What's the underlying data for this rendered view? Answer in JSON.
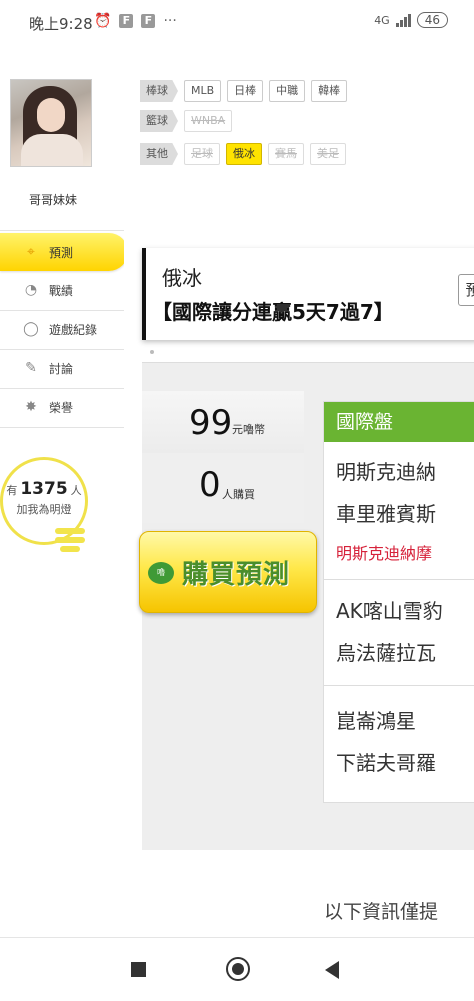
{
  "status_bar": {
    "time": "晚上9:28",
    "alarm_icon": "alarm-clock-icon",
    "notification_icons": [
      "F",
      "F"
    ],
    "more": "···",
    "network": "4G",
    "battery": "46"
  },
  "sidebar": {
    "user_name": "哥哥妹妹",
    "menu": [
      {
        "label": "預測",
        "icon": "target-icon",
        "active": true
      },
      {
        "label": "戰績",
        "icon": "chart-icon",
        "active": false
      },
      {
        "label": "遊戲紀錄",
        "icon": "record-icon",
        "active": false
      },
      {
        "label": "討論",
        "icon": "discussion-icon",
        "active": false
      },
      {
        "label": "榮譽",
        "icon": "honor-icon",
        "active": false
      }
    ],
    "lamp": {
      "prefix": "有",
      "count": "1375",
      "suffix": "人",
      "subtitle": "加我為明燈"
    }
  },
  "filters": {
    "baseball": {
      "category": "棒球",
      "tags": [
        "MLB",
        "日棒",
        "中職",
        "韓棒"
      ]
    },
    "basketball": {
      "category": "籃球",
      "tags": [
        "WNBA"
      ]
    },
    "other": {
      "category": "其他",
      "tags": [
        "足球",
        "俄冰",
        "賽馬",
        "美足"
      ],
      "selected": "俄冰"
    }
  },
  "title_box": {
    "sport": "俄冰",
    "headline": "【國際讓分連贏5天7過7】",
    "side_button": "預"
  },
  "pricing": {
    "price": "99",
    "price_unit": "元嚕幣",
    "buyers": "0",
    "buyers_unit": "人購買",
    "buy_button": "購買預測",
    "logo_text": "嚕"
  },
  "matches": {
    "header": "國際盤",
    "items": [
      {
        "team1": "明斯克迪納",
        "team2": "車里雅賓斯",
        "pick": "明斯克迪納摩"
      },
      {
        "team1": "AK喀山雪豹",
        "team2": "烏法薩拉瓦",
        "pick": ""
      },
      {
        "team1": "崑崙鴻星",
        "team2": "下諾夫哥羅",
        "pick": ""
      }
    ]
  },
  "footer_note": "以下資訊僅提",
  "colors": {
    "accent_yellow": "#ffe300",
    "header_green": "#6ab432",
    "pick_red": "#d6223a"
  }
}
